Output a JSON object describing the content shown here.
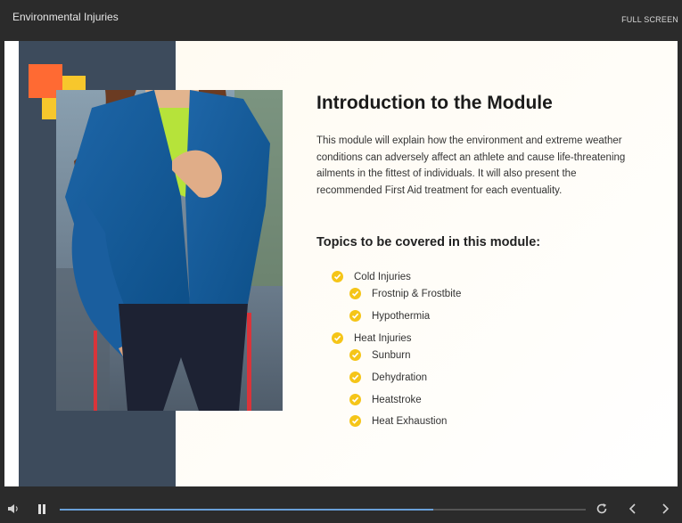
{
  "window": {
    "title": "Environmental Injuries",
    "fullscreen_label": "FULL SCREEN"
  },
  "slide": {
    "heading": "Introduction to the Module",
    "paragraph": "This module will explain how the environment and extreme weather conditions can adversely affect an athlete and cause life-threatening ailments in the fittest of individuals. It will also present the recommended First Aid treatment for each eventuality.",
    "topics_heading": "Topics to be covered in this module:",
    "topics": [
      {
        "label": "Cold Injuries"
      },
      {
        "label": "Frostnip & Frostbite"
      },
      {
        "label": "Hypothermia"
      },
      {
        "label": "Heat Injuries"
      },
      {
        "label": "Sunburn"
      },
      {
        "label": "Dehydration"
      },
      {
        "label": "Heatstroke"
      },
      {
        "label": "Heat Exhaustion"
      }
    ],
    "accent_colors": {
      "orange": "#ff6a33",
      "yellow": "#f7c72c",
      "panel": "#3d4b5c",
      "check": "#f5c518"
    }
  },
  "player": {
    "progress": 0.71,
    "icons": [
      "volume-icon",
      "pause-icon",
      "replay-icon",
      "previous-icon",
      "next-icon"
    ]
  }
}
